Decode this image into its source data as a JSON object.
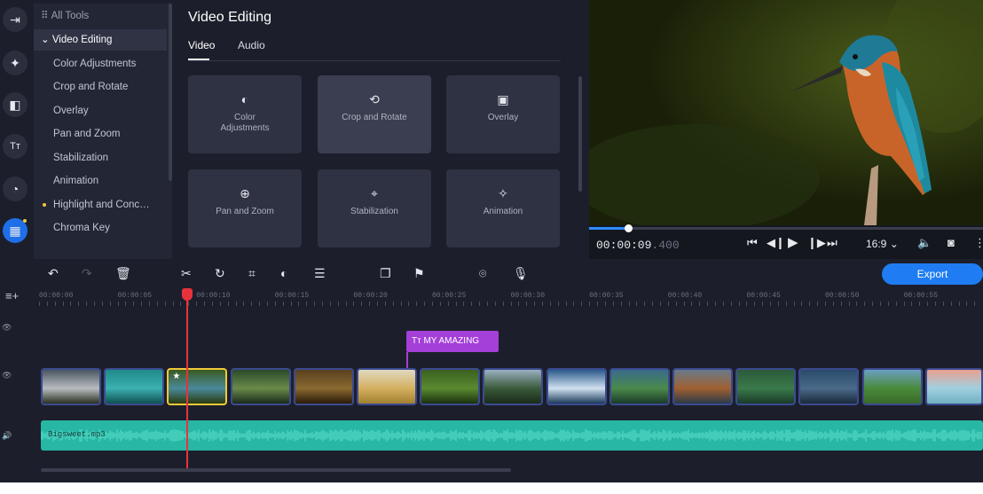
{
  "rail": {
    "items": [
      {
        "name": "import-icon",
        "glyph": "⇥"
      },
      {
        "name": "magic-wand-icon",
        "glyph": "✦"
      },
      {
        "name": "transitions-icon",
        "glyph": "◧"
      },
      {
        "name": "titles-icon",
        "glyph": "Tт"
      },
      {
        "name": "stickers-icon",
        "glyph": "◔"
      },
      {
        "name": "more-tools-icon",
        "glyph": "▦"
      }
    ]
  },
  "tools": {
    "header": "All Tools",
    "section": "Video Editing",
    "items": [
      "Color Adjustments",
      "Crop and Rotate",
      "Overlay",
      "Pan and Zoom",
      "Stabilization",
      "Animation",
      "Highlight and Conc…",
      "Chroma Key"
    ]
  },
  "panel": {
    "title": "Video Editing",
    "tabs": [
      "Video",
      "Audio"
    ],
    "tiles": [
      {
        "label": "Color Adjustments",
        "icon": "color-adjust-icon",
        "glyph": "◐"
      },
      {
        "label": "Crop and Rotate",
        "icon": "crop-rotate-icon",
        "glyph": "⟲"
      },
      {
        "label": "Overlay",
        "icon": "overlay-icon",
        "glyph": "▣"
      },
      {
        "label": "Pan and Zoom",
        "icon": "pan-zoom-icon",
        "glyph": "⊕"
      },
      {
        "label": "Stabilization",
        "icon": "stabilization-icon",
        "glyph": "⌖"
      },
      {
        "label": "Animation",
        "icon": "animation-icon",
        "glyph": "✧"
      }
    ]
  },
  "preview": {
    "timecode": "00:00:09",
    "timecode_ms": ".400",
    "aspect": "16:9 ⌄",
    "progress": 0.1
  },
  "toolbar": {
    "export_label": "Export"
  },
  "ruler": {
    "labels": [
      "00:00:00",
      "00:00:05",
      "00:00:10",
      "00:00:15",
      "00:00:20",
      "00:00:25",
      "00:00:30",
      "00:00:35",
      "00:00:40",
      "00:00:45",
      "00:00:50",
      "00:00:55"
    ]
  },
  "timeline": {
    "title_clip": "MY AMAZING",
    "audio_file": "Bigsweet.mp3",
    "clips": [
      {
        "colors": [
          "#4a5560",
          "#b8bcc0",
          "#2a3020"
        ]
      },
      {
        "colors": [
          "#1f8a8a",
          "#3cb0b0",
          "#0f5050"
        ]
      },
      {
        "colors": [
          "#3a5a20",
          "#4a8a9a",
          "#2a3a10"
        ],
        "selected": true
      },
      {
        "colors": [
          "#2a4a2a",
          "#6a8a4a",
          "#1a2a1a"
        ]
      },
      {
        "colors": [
          "#5a4020",
          "#8a6a30",
          "#2a1a08"
        ]
      },
      {
        "colors": [
          "#e0d8c0",
          "#d4b060",
          "#a08030"
        ]
      },
      {
        "colors": [
          "#3a6020",
          "#5a8a30",
          "#1a3010"
        ]
      },
      {
        "colors": [
          "#9ab0c0",
          "#3a5a3a",
          "#1a2a1a"
        ]
      },
      {
        "colors": [
          "#2a5a8a",
          "#d0e0f0",
          "#1a3a5a"
        ]
      },
      {
        "colors": [
          "#3a6a8a",
          "#4a8a4a",
          "#1a3a2a"
        ]
      },
      {
        "colors": [
          "#6a7a8a",
          "#a06030",
          "#2a3a4a"
        ]
      },
      {
        "colors": [
          "#2a5a3a",
          "#3a7a4a",
          "#1a3a2a"
        ]
      },
      {
        "colors": [
          "#2a4a6a",
          "#4a6a8a",
          "#1a2a3a"
        ]
      },
      {
        "colors": [
          "#6aa0c0",
          "#4a8a3a",
          "#3a6a2a"
        ]
      },
      {
        "colors": [
          "#e8a090",
          "#a0d0e0",
          "#70b0c0"
        ]
      }
    ]
  }
}
